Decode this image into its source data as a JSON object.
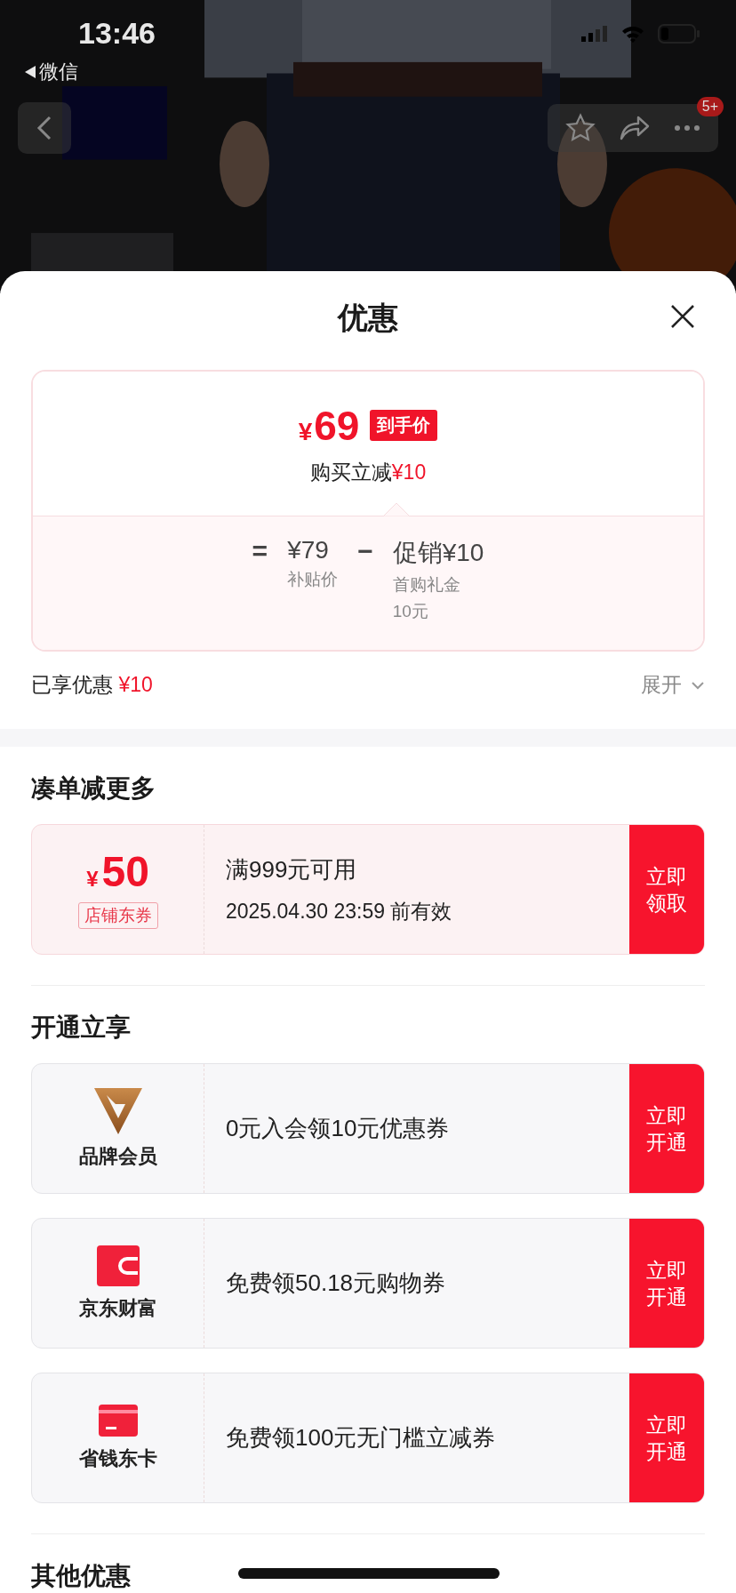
{
  "status_bar": {
    "time": "13:46",
    "back_app": "微信"
  },
  "nav": {
    "badge": "5+"
  },
  "sheet": {
    "title": "优惠",
    "price_card": {
      "currency": "¥",
      "price": "69",
      "tag": "到手价",
      "reduction_label": "购买立减",
      "reduction": "¥10",
      "equals": "=",
      "base_price": "¥79",
      "base_label": "补贴价",
      "minus": "−",
      "promo_price": "促销¥10",
      "promo_label": "首购礼金",
      "promo_note": "10元"
    },
    "enjoyed": {
      "label": "已享优惠",
      "amount": "¥10"
    },
    "expand": "展开",
    "sections": [
      {
        "title": "凑单减更多",
        "items": [
          {
            "kind": "coupon",
            "currency": "¥",
            "amount": "50",
            "tag": "店铺东券",
            "title": "满999元可用",
            "subtitle": "2025.04.30 23:59 前有效",
            "action": "立即领取"
          }
        ]
      },
      {
        "title": "开通立享",
        "items": [
          {
            "kind": "brand",
            "label": "品牌会员",
            "title": "0元入会领10元优惠券",
            "action": "立即开通"
          },
          {
            "kind": "wallet",
            "label": "京东财富",
            "title": "免费领50.18元购物券",
            "action": "立即开通"
          },
          {
            "kind": "card",
            "label": "省钱东卡",
            "title": "免费领100元无门槛立减券",
            "action": "立即开通"
          }
        ]
      },
      {
        "title": "其他优惠"
      }
    ]
  }
}
